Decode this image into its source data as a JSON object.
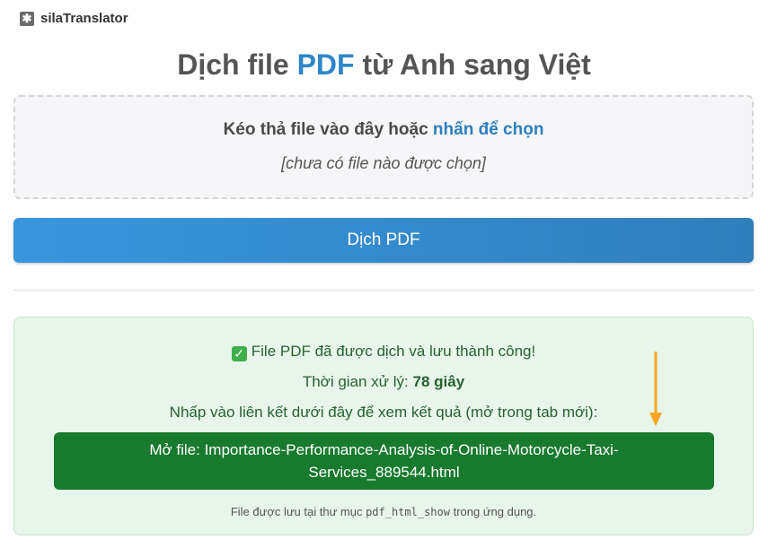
{
  "brand": {
    "icon": "star-icon",
    "name": "silaTranslator"
  },
  "title": {
    "prefix": "Dịch file ",
    "accent": "PDF",
    "suffix": " từ Anh sang Việt"
  },
  "dropzone": {
    "instruction": "Kéo thả file vào đây hoặc ",
    "link": "nhấn để chọn",
    "status": "[chưa có file nào được chọn]"
  },
  "translate_button": "Dịch PDF",
  "result": {
    "success": "File PDF đã được dịch và lưu thành công!",
    "time_label": "Thời gian xử lý: ",
    "time_value": "78 giây",
    "instruction": "Nhấp vào liên kết dưới đây để xem kết quả (mở trong tab mới):",
    "link_text": "Mở file: Importance-Performance-Analysis-of-Online-Motorcycle-Taxi-Services_889544.html",
    "note_prefix": "File được lưu tại thư mục ",
    "note_folder": "pdf_html_show",
    "note_suffix": " trong ứng dụng."
  },
  "colors": {
    "accent": "#2e86c8",
    "success_bg": "#e8f5ea",
    "link_button": "#187a2f",
    "arrow": "#f5a623"
  }
}
